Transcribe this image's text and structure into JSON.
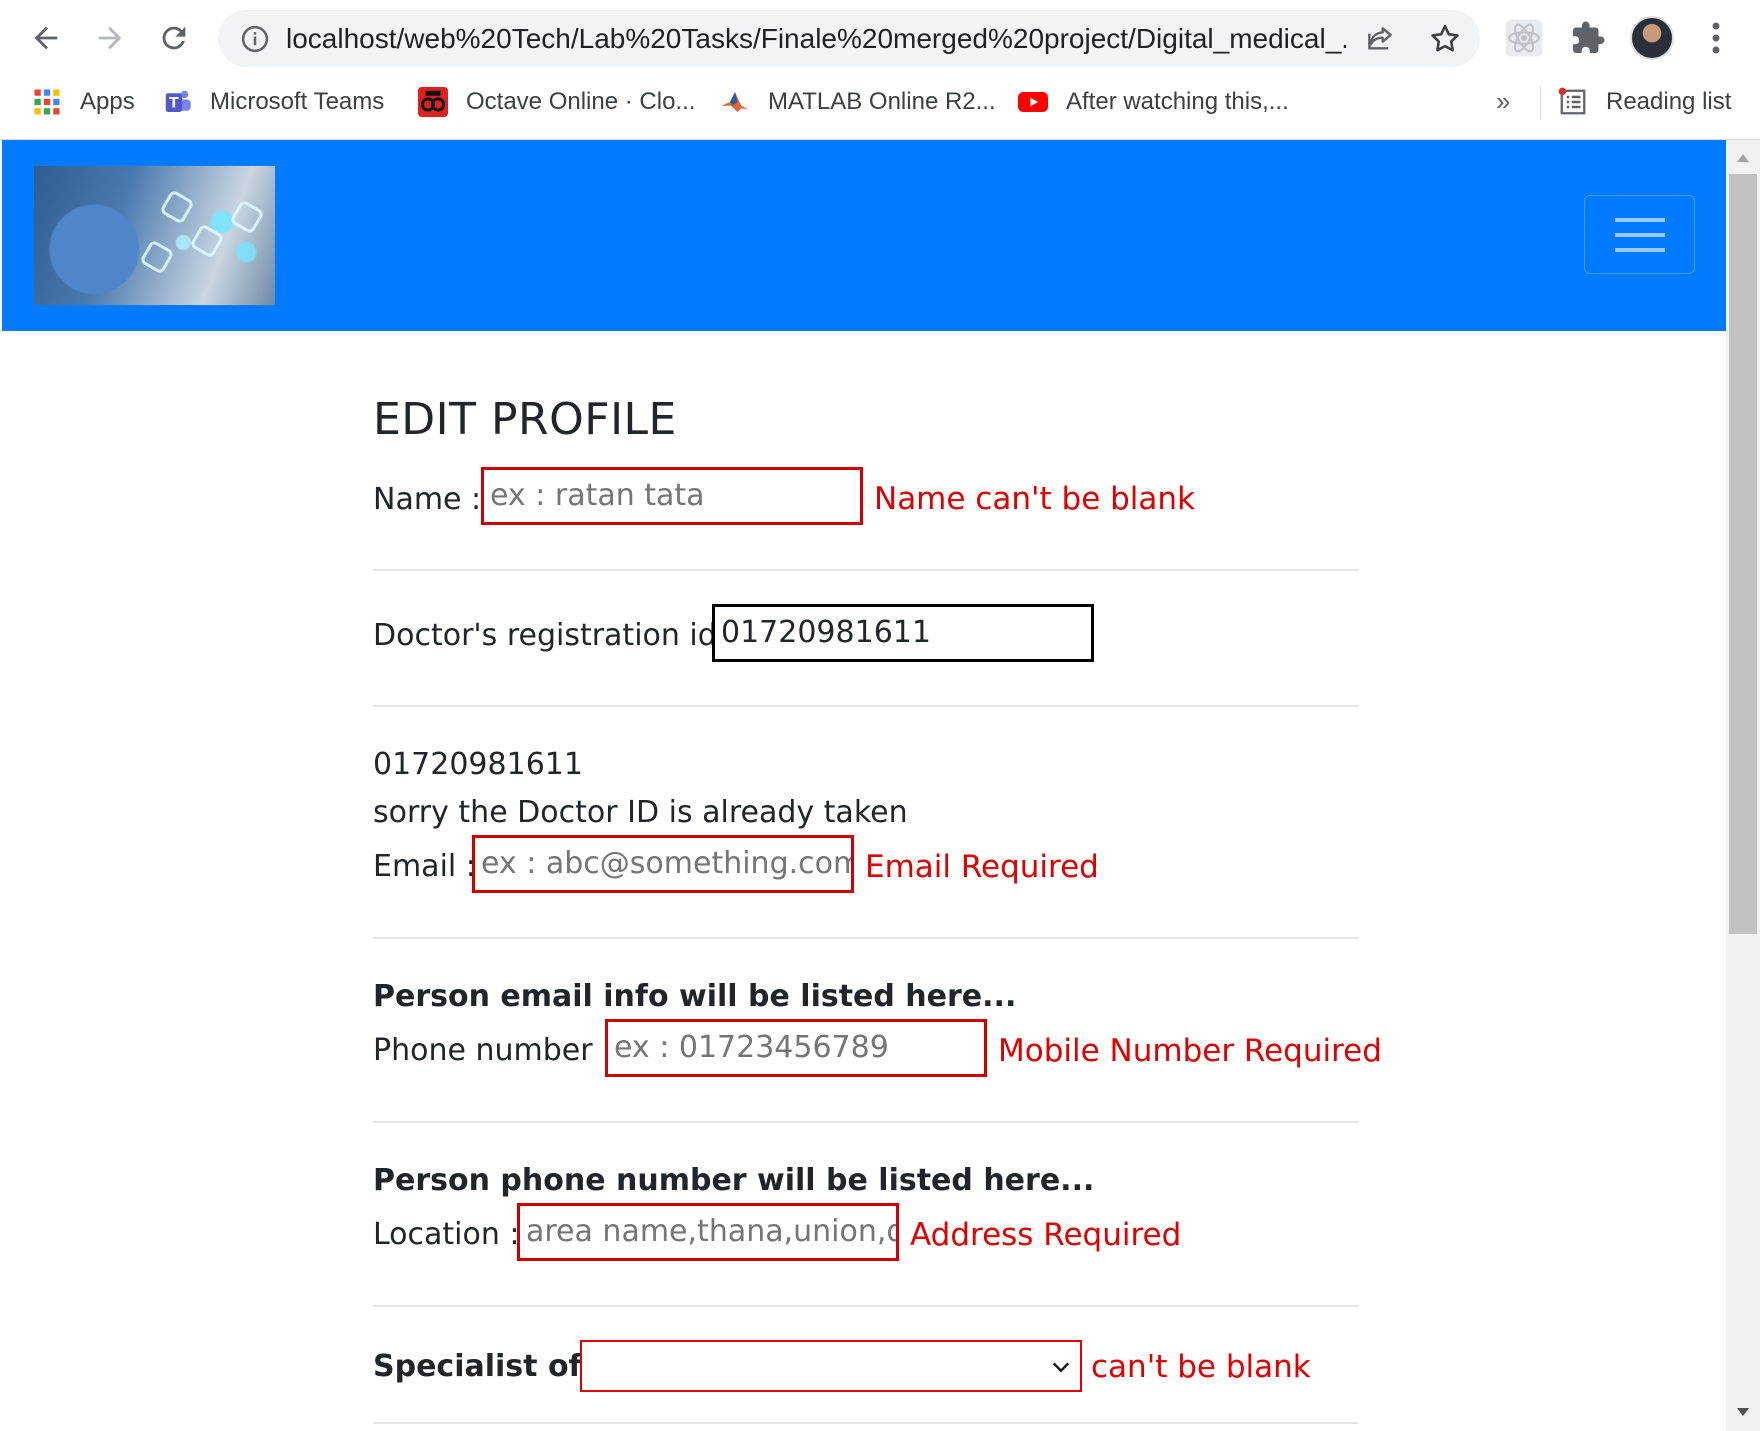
{
  "browser": {
    "url": "localhost/web%20Tech/Lab%20Tasks/Finale%20merged%20project/Digital_medical_...",
    "bookmarks": [
      {
        "label": "Apps",
        "icon": "apps-grid-icon"
      },
      {
        "label": "Microsoft Teams",
        "icon": "teams-icon"
      },
      {
        "label": "Octave Online · Clo...",
        "icon": "octave-icon"
      },
      {
        "label": "MATLAB Online R2...",
        "icon": "matlab-icon"
      },
      {
        "label": "After watching this,...",
        "icon": "youtube-icon"
      }
    ],
    "more_bookmarks": "»",
    "reading_list": "Reading list"
  },
  "page": {
    "title": "EDIT PROFILE",
    "name": {
      "label": "Name :",
      "placeholder": "ex : ratan tata",
      "error": "Name can't be blank"
    },
    "registration": {
      "label": "Doctor's registration id:",
      "value": "01720981611"
    },
    "id_echo": "01720981611",
    "id_taken_msg": "sorry the Doctor ID is already taken",
    "email": {
      "label": "Email :",
      "placeholder": "ex : abc@something.com",
      "error": "Email Required"
    },
    "email_info": "Person email info will be listed here...",
    "phone": {
      "label": "Phone number :",
      "placeholder": "ex : 01723456789",
      "error": "Mobile Number Required"
    },
    "phone_info": "Person phone number will be listed here...",
    "location": {
      "label": "Location :",
      "placeholder": "area name,thana,union,dis",
      "error": "Address Required"
    },
    "specialist": {
      "label": "Specialist of :",
      "selected": "",
      "error": "can't be blank"
    }
  },
  "colors": {
    "navbar": "#007bff",
    "error": "#e00000",
    "invalid_border": "#d10000"
  }
}
